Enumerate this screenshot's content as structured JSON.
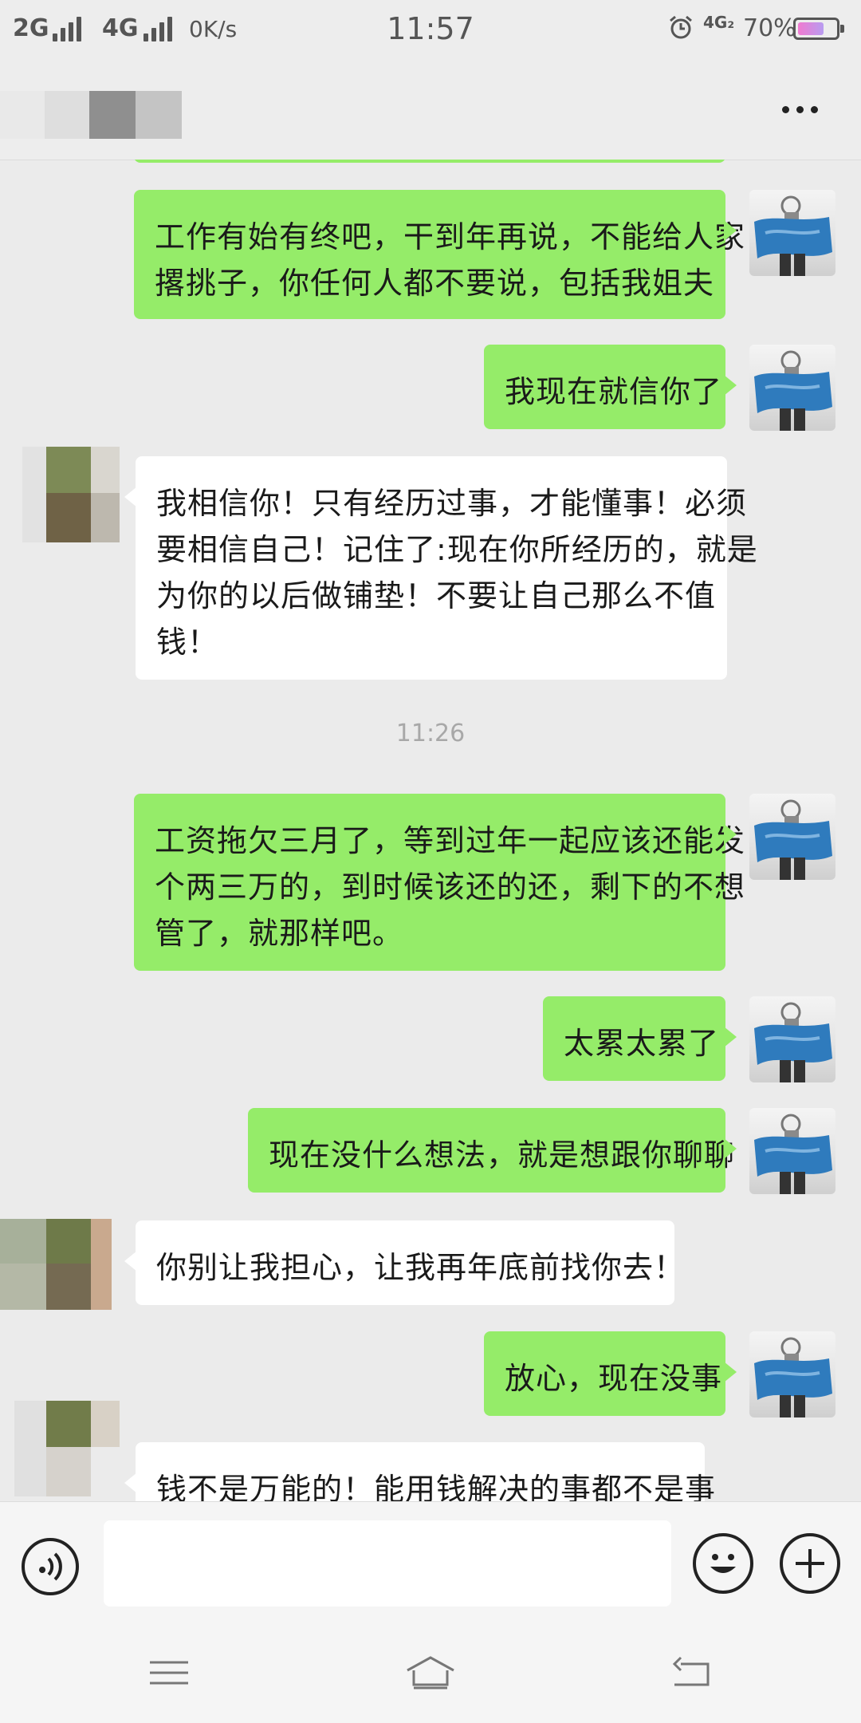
{
  "status_bar": {
    "net1": "2G",
    "net2": "4G",
    "speed": "0K/s",
    "time": "11:57",
    "net3": "4G₂",
    "battery_pct_text": "70%",
    "battery_level": 0.7
  },
  "messages": [
    {
      "side": "me",
      "lines": [
        "工作有始有终吧，干到年再说，不能给人家",
        "撂挑子，你任何人都不要说，包括我姐夫"
      ]
    },
    {
      "side": "me",
      "lines": [
        "我现在就信你了"
      ]
    },
    {
      "side": "them",
      "lines": [
        "我相信你！只有经历过事，才能懂事！必须",
        "要相信自己！记住了:现在你所经历的，就是",
        "为你的以后做铺垫！不要让自己那么不值",
        "钱！"
      ]
    },
    {
      "side": "me",
      "lines": [
        "工资拖欠三月了，等到过年一起应该还能发",
        "个两三万的，到时候该还的还，剩下的不想",
        "管了，就那样吧。"
      ]
    },
    {
      "side": "me",
      "lines": [
        "太累太累了"
      ]
    },
    {
      "side": "me",
      "lines": [
        "现在没什么想法，就是想跟你聊聊"
      ]
    },
    {
      "side": "them",
      "lines": [
        "你别让我担心，让我再年底前找你去！"
      ]
    },
    {
      "side": "me",
      "lines": [
        "放心，现在没事"
      ]
    },
    {
      "side": "them",
      "lines": [
        "钱不是万能的！能用钱解决的事都不是事"
      ]
    }
  ],
  "timestamp": "11:26",
  "input": {
    "value": "",
    "placeholder": ""
  },
  "icons": {
    "more": "more-icon",
    "voice": "voice-icon",
    "emoji": "emoji-icon",
    "plus": "plus-icon",
    "nav_menu": "menu-icon",
    "nav_home": "home-icon",
    "nav_back": "back-icon"
  },
  "colors": {
    "my_bubble": "#95ec69",
    "their_bubble": "#ffffff",
    "chat_background": "#ebebeb"
  }
}
